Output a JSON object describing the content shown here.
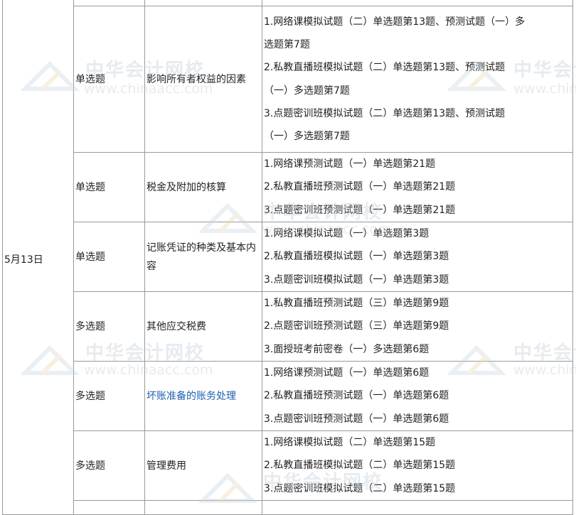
{
  "date": "5月13日",
  "rows": [
    {
      "type": "单选题",
      "topic": "影响所有者权益的因素",
      "topic_link": false,
      "height": 206,
      "lines": [
        "1.网络课模拟试题（二）单选题第13题、预测试题（一）多",
        "选题第7题",
        "2.私教直播班模拟试题（二）单选题第13题、预测试题",
        "（一）多选题第7题",
        "3.点题密训班模拟试题（二）单选题第13题、预测试题",
        "（一）多选题第7题"
      ]
    },
    {
      "type": "单选题",
      "topic": "税金及附加的核算",
      "topic_link": false,
      "height": 98,
      "lines": [
        "1.网络课预测试题（一）单选题第21题",
        "2.私教直播班预测试题（一）单选题第21题",
        "3.点题密训班预测试题（一）单选题第21题"
      ]
    },
    {
      "type": "单选题",
      "topic": "记账凭证的种类及基本内容",
      "topic_link": false,
      "height": 98,
      "lines": [
        "1.网络课模拟试题（一）单选题第3题",
        "2.私教直播班模拟试题（一）单选题第3题",
        "3.点题密训班模拟试题（一）单选题第3题"
      ]
    },
    {
      "type": "多选题",
      "topic": "其他应交税费",
      "topic_link": false,
      "height": 98,
      "lines": [
        "1.私教直播班预测试题（三）单选题第9题",
        "2.点题密训班预测试题（三）单选题第9题",
        "3.面授班考前密卷（一）多选题第6题"
      ]
    },
    {
      "type": "多选题",
      "topic": "坏账准备的账务处理",
      "topic_link": true,
      "height": 98,
      "lines": [
        "1.网络课预测试题（一）单选题第6题",
        "2.私教直播班预测试题（一）单选题第6题",
        "3.点题密训班预测试题（一）单选题第6题"
      ]
    },
    {
      "type": "多选题",
      "topic": "管理费用",
      "topic_link": false,
      "height": 98,
      "lines": [
        "1.网络课模拟试题（二）单选题第15题",
        "2.私教直播班模拟试题（二）单选题第15题",
        "3.点题密训班模拟试题（二）单选题第15题"
      ]
    }
  ],
  "watermark": {
    "cn": "中华会计网校",
    "en": "www.chinaacc.com"
  }
}
